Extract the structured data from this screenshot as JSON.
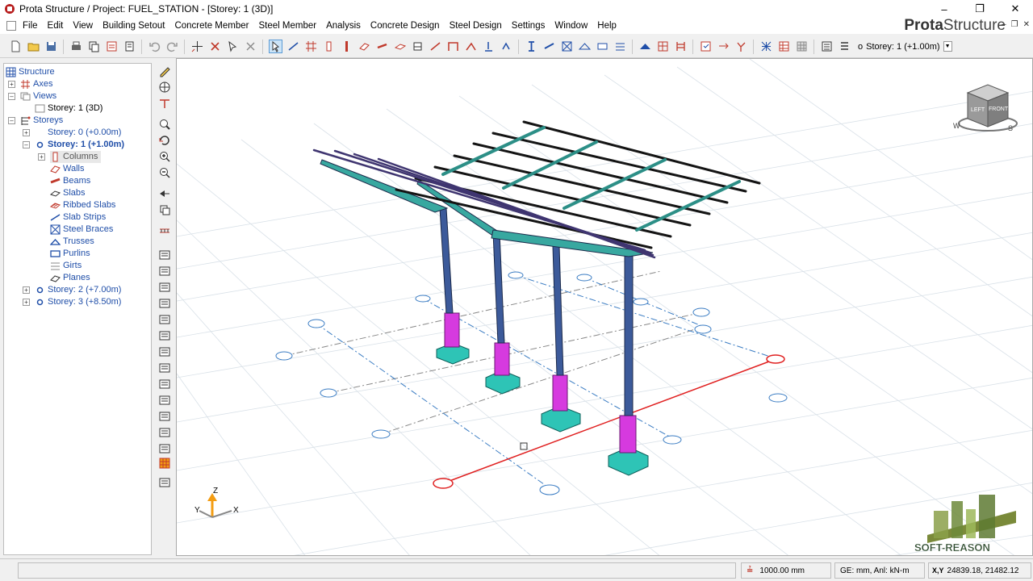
{
  "window": {
    "title": "Prota Structure / Project: FUEL_STATION - [Storey: 1 (3D)]",
    "brand_a": "Prota",
    "brand_b": "Structure",
    "minimize": "–",
    "maximize": "❐",
    "close": "✕"
  },
  "menu": {
    "items": [
      "File",
      "Edit",
      "View",
      "Building Setout",
      "Concrete Member",
      "Steel Member",
      "Analysis",
      "Concrete Design",
      "Steel Design",
      "Settings",
      "Window",
      "Help"
    ]
  },
  "toolbar": {
    "storey_selector": "Storey: 1 (+1.00m)"
  },
  "tree": {
    "items": [
      {
        "label": "Structure",
        "icon": "structure-icon"
      },
      {
        "label": "Axes",
        "icon": "axes-icon"
      },
      {
        "label": "Views",
        "icon": "views-icon"
      },
      {
        "label": "Storey: 1 (3D)",
        "icon": "view-icon"
      },
      {
        "label": "Storeys",
        "icon": "storeys-icon"
      },
      {
        "label": "Storey: 0 (+0.00m)",
        "icon": "storey-icon"
      },
      {
        "label": "Storey: 1 (+1.00m)",
        "icon": "storey-icon"
      },
      {
        "label": "Columns",
        "icon": "columns-icon"
      },
      {
        "label": "Walls",
        "icon": "walls-icon"
      },
      {
        "label": "Beams",
        "icon": "beams-icon"
      },
      {
        "label": "Slabs",
        "icon": "slabs-icon"
      },
      {
        "label": "Ribbed Slabs",
        "icon": "ribbed-slabs-icon"
      },
      {
        "label": "Slab Strips",
        "icon": "slab-strips-icon"
      },
      {
        "label": "Steel Braces",
        "icon": "steel-braces-icon"
      },
      {
        "label": "Trusses",
        "icon": "trusses-icon"
      },
      {
        "label": "Purlins",
        "icon": "purlins-icon"
      },
      {
        "label": "Girts",
        "icon": "girts-icon"
      },
      {
        "label": "Planes",
        "icon": "planes-icon"
      },
      {
        "label": "Storey: 2 (+7.00m)",
        "icon": "storey-icon"
      },
      {
        "label": "Storey: 3 (+8.50m)",
        "icon": "storey-icon"
      }
    ]
  },
  "viewport": {
    "axis_labels": {
      "z": "Z",
      "y": "Y",
      "x": "X"
    },
    "viewcube": {
      "left_face": "LEFT",
      "front_face": "FRONT",
      "west": "W",
      "south": "S"
    },
    "watermark": "SOFT-REASON"
  },
  "status": {
    "grid_size": "1000.00 mm",
    "units": "GE: mm,  Anl: kN-m",
    "coord_label": "X,Y",
    "coordinates": "24839.18, 21482.12"
  }
}
